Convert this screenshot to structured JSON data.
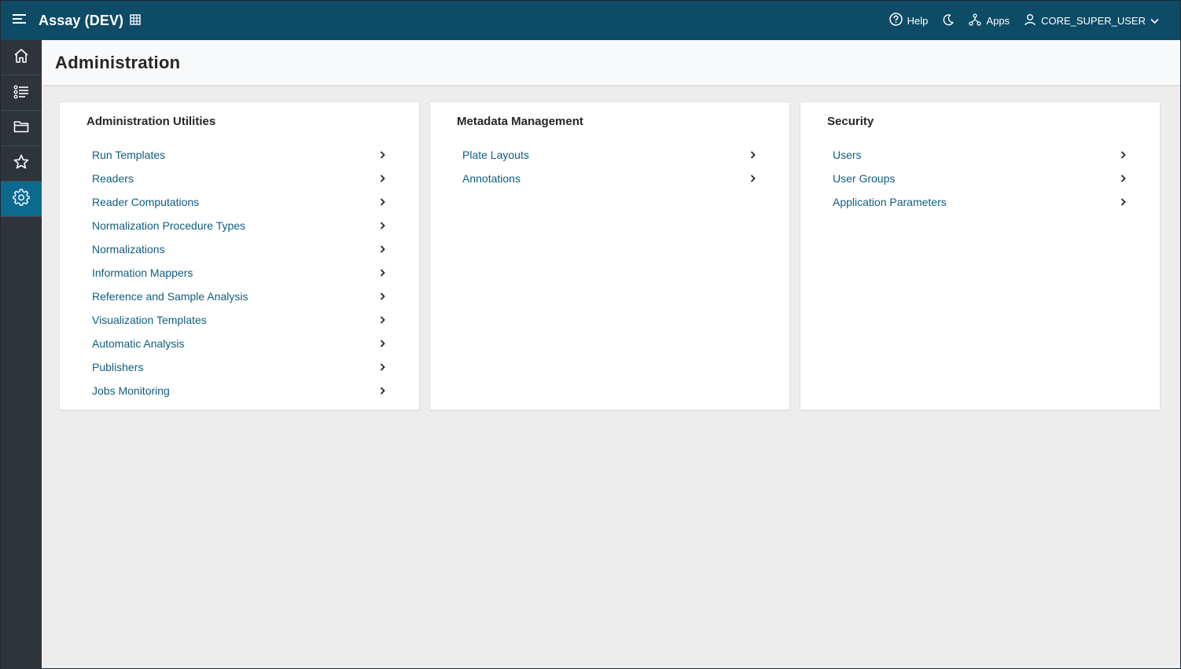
{
  "header": {
    "app_title": "Assay (DEV)",
    "help_label": "Help",
    "apps_label": "Apps",
    "user_label": "CORE_SUPER_USER"
  },
  "sidebar": {
    "items": [
      {
        "icon": "home-icon"
      },
      {
        "icon": "list-icon"
      },
      {
        "icon": "folder-icon"
      },
      {
        "icon": "star-icon"
      },
      {
        "icon": "gear-icon",
        "active": true
      }
    ]
  },
  "page": {
    "title": "Administration"
  },
  "cards": [
    {
      "title": "Administration Utilities",
      "links": [
        "Run Templates",
        "Readers",
        "Reader Computations",
        "Normalization Procedure Types",
        "Normalizations",
        "Information Mappers",
        "Reference and Sample Analysis",
        "Visualization Templates",
        "Automatic Analysis",
        "Publishers",
        "Jobs Monitoring"
      ]
    },
    {
      "title": "Metadata Management",
      "links": [
        "Plate Layouts",
        "Annotations"
      ]
    },
    {
      "title": "Security",
      "links": [
        "Users",
        "User Groups",
        "Application Parameters"
      ]
    }
  ],
  "colors": {
    "header_bg": "#0d4b66",
    "sidebar_bg": "#2f343b",
    "sidebar_active": "#0d6a8f",
    "link": "#0f5d7f"
  }
}
